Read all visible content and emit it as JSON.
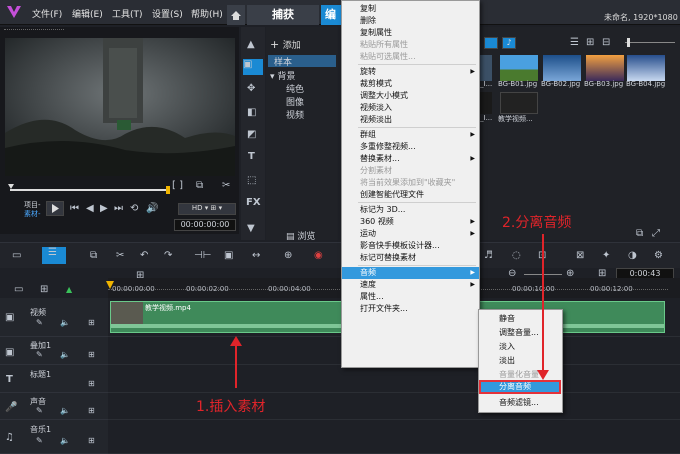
{
  "app": {
    "menus": [
      "文件(F)",
      "编辑(E)",
      "工具(T)",
      "设置(S)",
      "帮助(H)"
    ],
    "tabs": {
      "capture": "捕获",
      "edit": "编"
    },
    "project_info": "未命名, 1920*1080"
  },
  "player": {
    "project_label": "项目-",
    "clip_label": "素材-",
    "timecode": "00:00:00:00",
    "brackets": "[ ]"
  },
  "library": {
    "add_label": "添加",
    "tree": [
      "样本",
      "背景",
      "纯色",
      "图像",
      "视频"
    ],
    "browse_label": "浏览",
    "thumbnails": [
      {
        "label": "_I...",
        "color": "#3b5066"
      },
      {
        "label": "BG-B01.jpg",
        "color": "#2f7bc0"
      },
      {
        "label": "BG-B02.jpg",
        "color": "#1d4f8a"
      },
      {
        "label": "BG-B03.jpg",
        "color": "#c06a2a"
      },
      {
        "label": "BG-B04.jpg",
        "color": "#274e8c"
      },
      {
        "label": "_I...",
        "color": "#1a1a1a"
      },
      {
        "label": "教学视频...",
        "color": "#222"
      }
    ]
  },
  "timeline": {
    "ticks": [
      "00:00:00:00",
      "00:00:02:00",
      "00:00:04:00",
      "00:00:10:00",
      "00:00:12:00"
    ],
    "right_timecode": "0:00:43",
    "tracks": [
      {
        "name": "视频",
        "icon": "video-track-icon"
      },
      {
        "name": "叠加1",
        "icon": "overlay-track-icon"
      },
      {
        "name": "标题1",
        "icon": "title-track-icon"
      },
      {
        "name": "声音",
        "icon": "voice-track-icon"
      },
      {
        "name": "音乐1",
        "icon": "music-track-icon"
      }
    ],
    "clip_name": "教学视频.mp4"
  },
  "context_menu": {
    "items": [
      {
        "label": "复制",
        "disabled": false,
        "arrow": false
      },
      {
        "label": "删除",
        "disabled": false,
        "arrow": false
      },
      {
        "label": "复制属性",
        "disabled": false,
        "arrow": false
      },
      {
        "label": "粘贴所有属性",
        "disabled": true,
        "arrow": false
      },
      {
        "label": "粘贴可选属性...",
        "disabled": true,
        "arrow": false
      },
      {
        "sep": true
      },
      {
        "label": "旋转",
        "disabled": false,
        "arrow": true
      },
      {
        "label": "裁剪模式",
        "disabled": false,
        "arrow": false
      },
      {
        "label": "调整大小模式",
        "disabled": false,
        "arrow": false
      },
      {
        "label": "视频淡入",
        "disabled": false,
        "arrow": false
      },
      {
        "label": "视频淡出",
        "disabled": false,
        "arrow": false
      },
      {
        "sep": true
      },
      {
        "label": "群组",
        "disabled": false,
        "arrow": true
      },
      {
        "label": "多重修整视频...",
        "disabled": false,
        "arrow": false
      },
      {
        "label": "替换素材...",
        "disabled": false,
        "arrow": true
      },
      {
        "label": "分割素材",
        "disabled": true,
        "arrow": false
      },
      {
        "label": "将当前效果添加到\"收藏夹\"",
        "disabled": true,
        "arrow": false
      },
      {
        "label": "创建智能代理文件",
        "disabled": false,
        "arrow": false
      },
      {
        "sep": true
      },
      {
        "label": "标记为 3D...",
        "disabled": false,
        "arrow": false
      },
      {
        "label": "360 视频",
        "disabled": false,
        "arrow": true
      },
      {
        "label": "运动",
        "disabled": false,
        "arrow": true
      },
      {
        "label": "影音快手模板设计器...",
        "disabled": false,
        "arrow": false
      },
      {
        "label": "标记可替换素材",
        "disabled": false,
        "arrow": false
      },
      {
        "sep": true
      },
      {
        "label": "音频",
        "disabled": false,
        "arrow": true,
        "highlight": true
      },
      {
        "label": "速度",
        "disabled": false,
        "arrow": true
      },
      {
        "label": "属性...",
        "disabled": false,
        "arrow": false
      },
      {
        "label": "打开文件夹...",
        "disabled": false,
        "arrow": false
      }
    ]
  },
  "audio_submenu": {
    "items": [
      {
        "label": "静音",
        "disabled": false
      },
      {
        "label": "调整音量...",
        "disabled": false
      },
      {
        "label": "淡入",
        "disabled": false
      },
      {
        "label": "淡出",
        "disabled": false
      },
      {
        "label": "音量化音量",
        "disabled": true
      },
      {
        "label": "分离音频",
        "disabled": false,
        "selected": true
      },
      {
        "label": "音频滤镜...",
        "disabled": false
      }
    ]
  },
  "annotations": {
    "step1": "1.插入素材",
    "step2": "2.分离音频",
    "color": "#e0242a"
  }
}
